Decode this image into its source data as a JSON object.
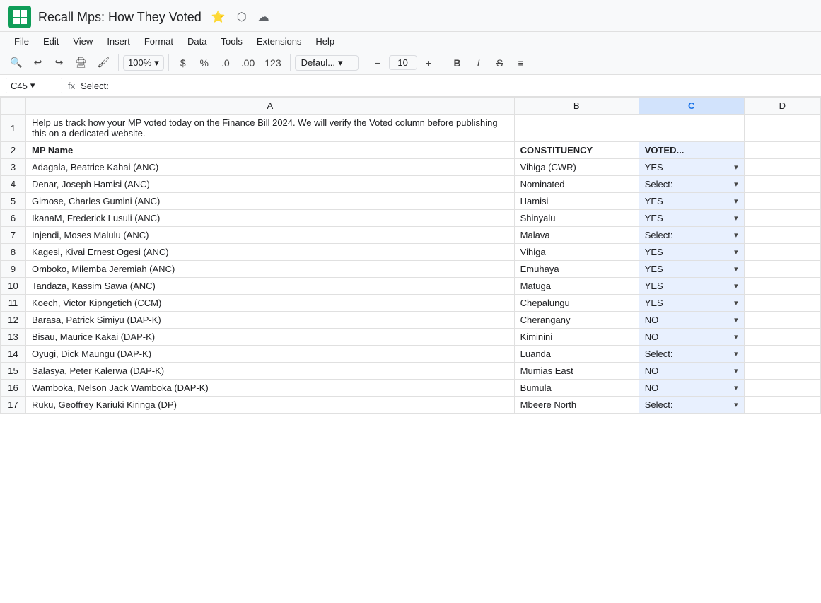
{
  "app": {
    "icon_alt": "Google Sheets",
    "title": "Recall Mps: How They Voted",
    "star_icon": "⭐",
    "drive_icon": "⬡",
    "cloud_icon": "☁"
  },
  "menu": {
    "items": [
      "File",
      "Edit",
      "View",
      "Insert",
      "Format",
      "Data",
      "Tools",
      "Extensions",
      "Help"
    ]
  },
  "toolbar": {
    "zoom": "100%",
    "currency": "$",
    "percent": "%",
    "decimal_dec": ".0",
    "decimal_inc": ".00",
    "number_format": "123",
    "font": "Defaul...",
    "font_size": "10",
    "bold": "B",
    "italic": "I"
  },
  "formula_bar": {
    "cell_ref": "C45",
    "fx": "fx",
    "formula": "Select:"
  },
  "columns": {
    "row_col": "",
    "A": "A",
    "B": "B",
    "C": "C",
    "D": "D"
  },
  "rows": [
    {
      "num": "1",
      "a": "Help us track how your MP voted today on the Finance Bill 2024. We will verify the Voted column before publishing this on a dedicated website.",
      "b": "",
      "c": "",
      "d": "",
      "is_desc": true
    },
    {
      "num": "2",
      "a": "MP Name",
      "b": "CONSTITUENCY",
      "c": "VOTED...",
      "d": "",
      "is_header": true
    },
    {
      "num": "3",
      "a": "Adagala, Beatrice Kahai (ANC)",
      "b": "Vihiga (CWR)",
      "c": "YES",
      "d": ""
    },
    {
      "num": "4",
      "a": "Denar, Joseph Hamisi (ANC)",
      "b": "Nominated",
      "c": "Select:",
      "d": ""
    },
    {
      "num": "5",
      "a": "Gimose, Charles Gumini (ANC)",
      "b": "Hamisi",
      "c": "YES",
      "d": ""
    },
    {
      "num": "6",
      "a": "IkanaM, Frederick Lusuli (ANC)",
      "b": "Shinyalu",
      "c": "YES",
      "d": ""
    },
    {
      "num": "7",
      "a": "Injendi, Moses Malulu (ANC)",
      "b": "Malava",
      "c": "Select:",
      "d": ""
    },
    {
      "num": "8",
      "a": "Kagesi, Kivai Ernest Ogesi (ANC)",
      "b": "Vihiga",
      "c": "YES",
      "d": ""
    },
    {
      "num": "9",
      "a": "Omboko, Milemba Jeremiah (ANC)",
      "b": "Emuhaya",
      "c": "YES",
      "d": ""
    },
    {
      "num": "10",
      "a": "Tandaza, Kassim Sawa (ANC)",
      "b": "Matuga",
      "c": "YES",
      "d": ""
    },
    {
      "num": "11",
      "a": "Koech, Victor Kipngetich (CCM)",
      "b": "Chepalungu",
      "c": "YES",
      "d": ""
    },
    {
      "num": "12",
      "a": "Barasa, Patrick Simiyu (DAP-K)",
      "b": "Cherangany",
      "c": "NO",
      "d": ""
    },
    {
      "num": "13",
      "a": "Bisau, Maurice Kakai (DAP-K)",
      "b": "Kiminini",
      "c": "NO",
      "d": ""
    },
    {
      "num": "14",
      "a": "Oyugi, Dick Maungu (DAP-K)",
      "b": "Luanda",
      "c": "Select:",
      "d": ""
    },
    {
      "num": "15",
      "a": "Salasya, Peter Kalerwa (DAP-K)",
      "b": "Mumias East",
      "c": "NO",
      "d": ""
    },
    {
      "num": "16",
      "a": "Wamboka, Nelson Jack Wamboka (DAP-K)",
      "b": "Bumula",
      "c": "NO",
      "d": ""
    },
    {
      "num": "17",
      "a": "Ruku, Geoffrey Kariuki Kiringa (DP)",
      "b": "Mbeere North",
      "c": "Select:",
      "d": ""
    }
  ]
}
